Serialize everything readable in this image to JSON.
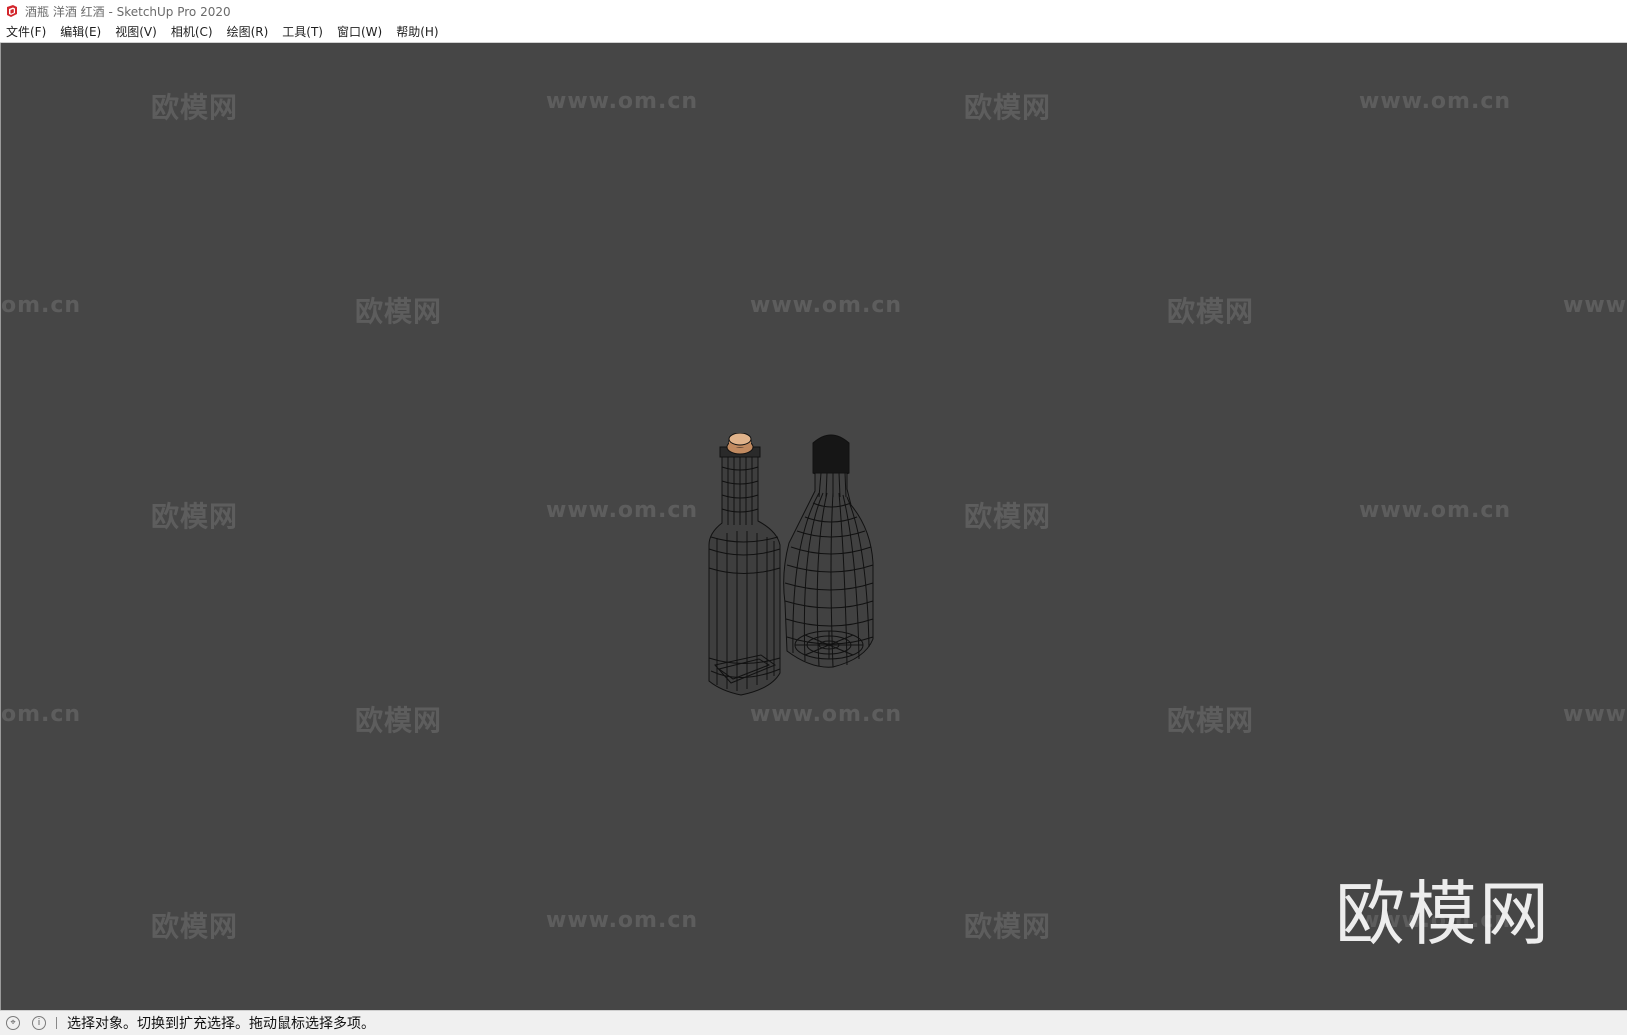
{
  "window": {
    "title": "酒瓶 洋酒 红酒 - SketchUp Pro 2020",
    "app_icon": "sketchup-logo-icon"
  },
  "menubar": {
    "items": [
      {
        "label": "文件(F)"
      },
      {
        "label": "编辑(E)"
      },
      {
        "label": "视图(V)"
      },
      {
        "label": "相机(C)"
      },
      {
        "label": "绘图(R)"
      },
      {
        "label": "工具(T)"
      },
      {
        "label": "窗口(W)"
      },
      {
        "label": "帮助(H)"
      }
    ]
  },
  "viewport": {
    "background": "#464646",
    "watermark_brand": "欧模网",
    "watermark_url": "www.om.cn",
    "watermark_url_partial_left": "om.cn",
    "watermark_url_partial_right": "www.",
    "watermark_big": "欧模网",
    "model": {
      "objects": [
        "wine-bottle-with-cork",
        "wine-bottle-with-cap"
      ],
      "cork_color": "#d7a77e",
      "wire_color": "#111111"
    }
  },
  "statusbar": {
    "icons": [
      "geolocation-icon",
      "info-icon"
    ],
    "message": "选择对象。切换到扩充选择。拖动鼠标选择多项。"
  }
}
